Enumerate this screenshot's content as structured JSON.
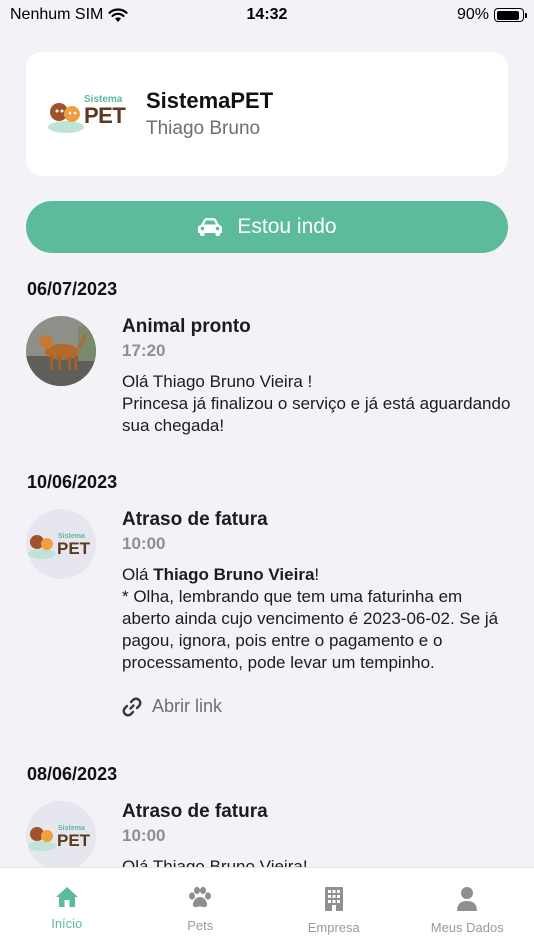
{
  "status_bar": {
    "carrier": "Nenhum SIM",
    "time": "14:32",
    "battery": "90%",
    "battery_level": 0.9
  },
  "header": {
    "logo_top": "Sistema",
    "logo_main": "PET",
    "title": "SistemaPET",
    "subtitle": "Thiago Bruno"
  },
  "action_button": {
    "label": "Estou indo",
    "icon": "car-icon"
  },
  "feed": [
    {
      "date": "06/07/2023",
      "title": "Animal pronto",
      "time": "17:20",
      "message": "Olá Thiago Bruno Vieira !\nPrincesa já finalizou o serviço e já está aguardando sua chegada!",
      "avatar": "dog-photo"
    },
    {
      "date": "10/06/2023",
      "title": "Atraso de fatura",
      "time": "10:00",
      "message_prefix": "Olá ",
      "message_bold": "Thiago Bruno Vieira",
      "message_suffix": "!\n* Olha, lembrando que tem uma faturinha em aberto ainda cujo vencimento é 2023-06-02. Se já pagou, ignora, pois entre o pagamento e o processamento, pode levar um tempinho.",
      "link_label": "Abrir link",
      "avatar": "sistemapet-logo"
    },
    {
      "date": "08/06/2023",
      "title": "Atraso de fatura",
      "time": "10:00",
      "message_partial": "Olá Thiago Bruno Vieira!",
      "avatar": "sistemapet-logo"
    }
  ],
  "tabs": [
    {
      "label": "Início",
      "icon": "home-icon",
      "active": true
    },
    {
      "label": "Pets",
      "icon": "paw-icon",
      "active": false
    },
    {
      "label": "Empresa",
      "icon": "building-icon",
      "active": false
    },
    {
      "label": "Meus Dados",
      "icon": "user-icon",
      "active": false
    }
  ],
  "colors": {
    "accent": "#5bbb9a",
    "background": "#f2f2f7",
    "brand_brown": "#5a3a1f"
  }
}
